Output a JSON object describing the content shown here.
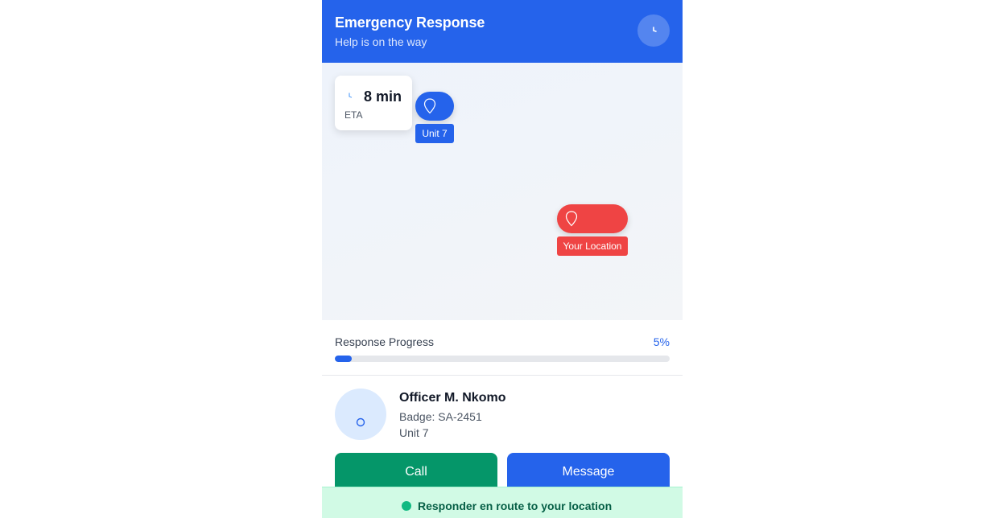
{
  "header": {
    "title": "Emergency Response",
    "subtitle": "Help is on the way",
    "clock_icon": "clock-icon"
  },
  "map": {
    "eta": {
      "value": "8 min",
      "label": "ETA",
      "icon": "clock-icon"
    },
    "unit_marker": {
      "label": "Unit 7",
      "icon": "map-pin-icon",
      "color": "#2563eb"
    },
    "user_marker": {
      "label": "Your Location",
      "icon": "map-pin-icon",
      "color": "#ef4444"
    }
  },
  "progress": {
    "title": "Response Progress",
    "value_text": "5%",
    "percent": 5
  },
  "officer": {
    "name": "Officer M. Nkomo",
    "badge": "Badge: SA-2451",
    "unit": "Unit 7",
    "avatar_icon": "user-icon"
  },
  "actions": {
    "call_label": "Call",
    "message_label": "Message"
  },
  "status": {
    "text": "Responder en route to your location",
    "color": "#10b981"
  },
  "colors": {
    "primary": "#2563eb",
    "danger": "#ef4444",
    "success": "#059669"
  }
}
